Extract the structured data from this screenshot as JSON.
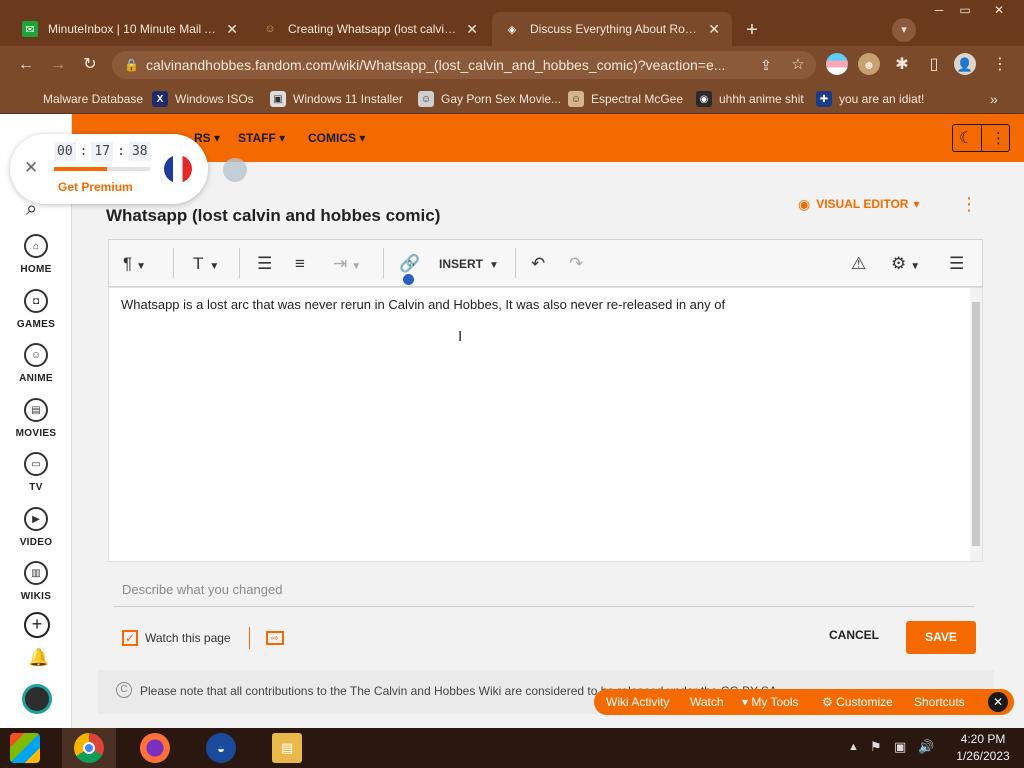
{
  "browser": {
    "tabs": [
      {
        "title": "MinuteInbox | 10 Minute Mail Ad",
        "favicon": "envelope-icon"
      },
      {
        "title": "Creating Whatsapp (lost calvin and",
        "favicon": "calvin-icon"
      },
      {
        "title": "Discuss Everything About Roblox",
        "favicon": "roblox-icon"
      }
    ],
    "url": "calvinandhobbes.fandom.com/wiki/Whatsapp_(lost_calvin_and_hobbes_comic)?veaction=e...",
    "bookmarks": [
      "Malware Database",
      "Windows ISOs",
      "Windows 11 Installer",
      "Gay Porn Sex Movie...",
      "Espectral McGee",
      "uhhh anime shit",
      "you are an idiat!"
    ],
    "bookmarks_more": "»"
  },
  "wiki": {
    "nav": [
      "RS",
      "STAFF",
      "COMICS"
    ],
    "rail": [
      {
        "label": "HOME",
        "icon": "home-icon"
      },
      {
        "label": "GAMES",
        "icon": "gamepad-icon"
      },
      {
        "label": "ANIME",
        "icon": "anime-icon"
      },
      {
        "label": "MOVIES",
        "icon": "movie-icon"
      },
      {
        "label": "TV",
        "icon": "tv-icon"
      },
      {
        "label": "VIDEO",
        "icon": "video-icon"
      },
      {
        "label": "WIKIS",
        "icon": "book-icon"
      }
    ]
  },
  "timer": {
    "hours": "00",
    "minutes": "17",
    "seconds": "38",
    "premium": "Get Premium",
    "progress": 0.55
  },
  "editor": {
    "page_title": "Whatsapp (lost calvin and hobbes comic)",
    "mode": "VISUAL EDITOR",
    "insert_label": "INSERT",
    "body_text": "Whatsapp is a lost arc that was never rerun in Calvin and Hobbes, It was also never re-released in any of",
    "summary_placeholder": "Describe what you changed",
    "watch_label": "Watch this page",
    "cancel_label": "CANCEL",
    "save_label": "SAVE",
    "notice": "Please note that all contributions to the The Calvin and Hobbes Wiki are considered to be released under the CC-BY-SA"
  },
  "wikibar": {
    "items": [
      "Wiki Activity",
      "Watch",
      "My Tools",
      "Customize",
      "Shortcuts"
    ]
  },
  "taskbar": {
    "time": "4:20 PM",
    "date": "1/26/2023"
  },
  "colors": {
    "accent": "#f56a00",
    "browser_frame": "#7a4a2a"
  }
}
